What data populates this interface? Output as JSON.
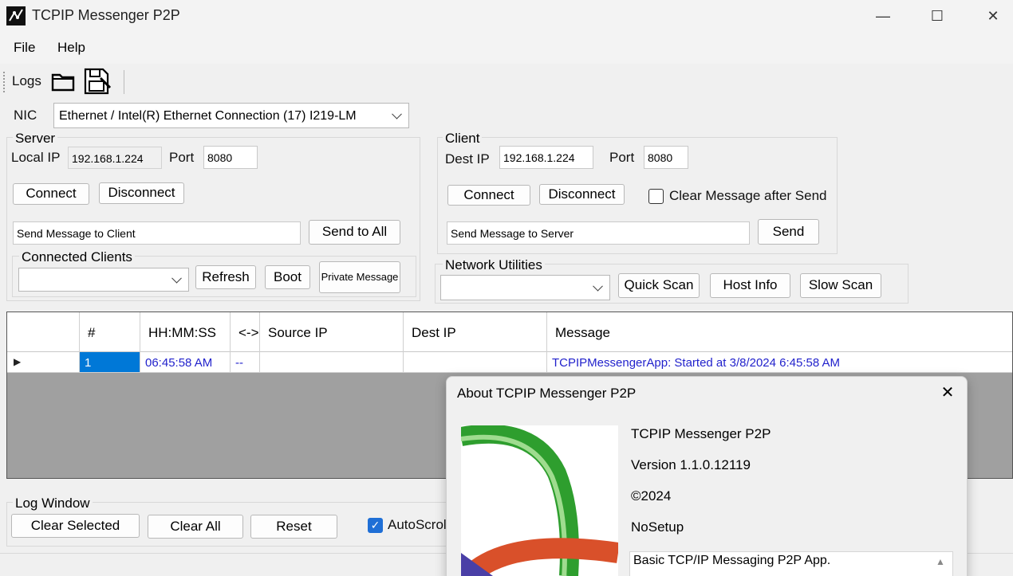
{
  "window": {
    "title": "TCPIP Messenger P2P",
    "controls": {
      "minimize": "—",
      "maximize": "☐",
      "close": "✕"
    }
  },
  "menu": {
    "file": "File",
    "help": "Help"
  },
  "toolbar": {
    "logs_label": "Logs"
  },
  "nic": {
    "label": "NIC",
    "selected": "Ethernet / Intel(R) Ethernet Connection (17) I219-LM"
  },
  "server": {
    "group_title": "Server",
    "local_ip_label": "Local IP",
    "local_ip": "192.168.1.224",
    "port_label": "Port",
    "port": "8080",
    "connect": "Connect",
    "disconnect": "Disconnect",
    "message": "Send Message to Client",
    "send_all": "Send to All",
    "clients_group_title": "Connected Clients",
    "refresh": "Refresh",
    "boot": "Boot",
    "private_message": "Private Message"
  },
  "client": {
    "group_title": "Client",
    "dest_ip_label": "Dest IP",
    "dest_ip": "192.168.1.224",
    "port_label": "Port",
    "port": "8080",
    "connect": "Connect",
    "disconnect": "Disconnect",
    "clear_after_send_label": "Clear Message after Send",
    "clear_after_send": false,
    "message": "Send Message to Server",
    "send": "Send"
  },
  "network_utilities": {
    "group_title": "Network Utilities",
    "quick_scan": "Quick Scan",
    "host_info": "Host Info",
    "slow_scan": "Slow Scan"
  },
  "grid": {
    "columns": [
      "",
      "#",
      "HH:MM:SS",
      "<->",
      "Source IP",
      "Dest IP",
      "Message"
    ],
    "rows": [
      {
        "marker": "▶",
        "num": "1",
        "time": "06:45:58 AM",
        "dir": "--",
        "src": "",
        "dest": "",
        "message": "TCPIPMessengerApp: Started at 3/8/2024 6:45:58 AM"
      }
    ]
  },
  "log_window": {
    "group_title": "Log Window",
    "clear_selected": "Clear Selected",
    "clear_all": "Clear All",
    "reset": "Reset",
    "autoscroll_label": "AutoScroll",
    "autoscroll": true
  },
  "about": {
    "title": "About TCPIP Messenger P2P",
    "close": "✕",
    "product": "TCPIP Messenger P2P",
    "version": "Version 1.1.0.12119",
    "copyright": "©2024",
    "company": "NoSetup",
    "description_line1": "Basic TCP/IP Messaging P2P App."
  },
  "colors": {
    "grid_background": "#a0a0a0",
    "selected_cell": "#0078d7",
    "row_text": "#2222cc",
    "logo_green": "#2e9e2e",
    "logo_red": "#d9502a"
  }
}
